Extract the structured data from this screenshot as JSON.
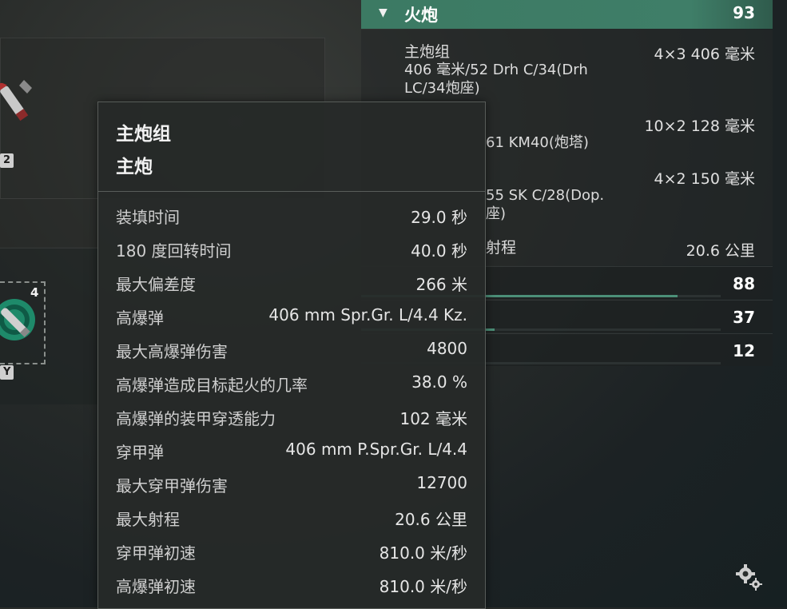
{
  "left": {
    "badge_top": "2",
    "badge_bottom": "Y",
    "torpedo_count": "4"
  },
  "panel": {
    "header_title": "火炮",
    "header_value": "93",
    "main_battery_label": "主炮组",
    "main_battery_value": "4×3  406 毫米",
    "main_battery_desc_1": "406  毫米/52  Drh  C/34(Drh",
    "main_battery_desc_2": "LC/34炮座)",
    "secondary_1_value": "10×2  128 毫米",
    "secondary_1_desc": "61  KM40(炮塔)",
    "secondary_2_value": "4×2  150 毫米",
    "secondary_2_desc_1": "55  SK  C/28(Dop.",
    "secondary_2_desc_2": "座)",
    "range_label": "射程",
    "range_value": "20.6 公里",
    "stats": [
      {
        "value": "88",
        "fill": 0.88
      },
      {
        "value": "37",
        "fill": 0.37
      },
      {
        "value": "12",
        "fill": 0.0
      }
    ]
  },
  "tooltip": {
    "title": "主炮组",
    "subtitle": "主炮",
    "rows": [
      {
        "label": "装填时间",
        "value": "29.0 秒"
      },
      {
        "label": "180  度回转时间",
        "value": "40.0 秒"
      },
      {
        "label": "最大偏差度",
        "value": "266 米"
      },
      {
        "label": "高爆弹",
        "value": "406  mm  Spr.Gr.  L/4.4  Kz."
      },
      {
        "label": "最大高爆弹伤害",
        "value": "4800"
      },
      {
        "label": "高爆弹造成目标起火的几率",
        "value": "38.0 %"
      },
      {
        "label": "高爆弹的装甲穿透能力",
        "value": "102 毫米"
      },
      {
        "label": "穿甲弹",
        "value": "406  mm  P.Spr.Gr.  L/4.4"
      },
      {
        "label": "最大穿甲弹伤害",
        "value": "12700"
      },
      {
        "label": "最大射程",
        "value": "20.6 公里"
      },
      {
        "label": "穿甲弹初速",
        "value": "810.0 米/秒"
      },
      {
        "label": "高爆弹初速",
        "value": "810.0 米/秒"
      }
    ]
  },
  "icons": {
    "settings": "gear-icon",
    "collapse": "triangle-down-icon",
    "shell": "shell-icon",
    "torpedo": "torpedo-icon"
  }
}
